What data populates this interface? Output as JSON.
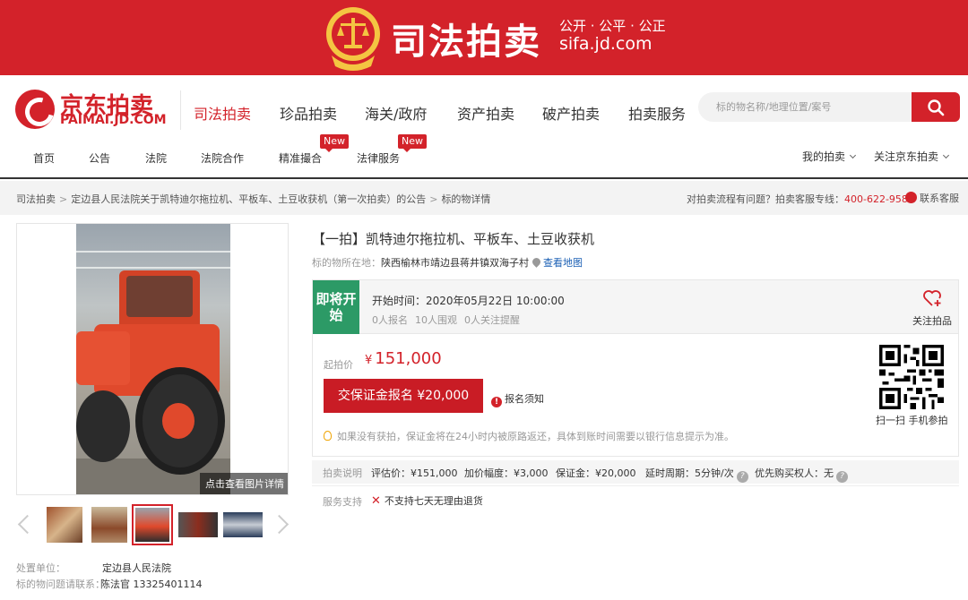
{
  "banner": {
    "title": "司法拍卖",
    "slogan": "公开 · 公平 · 公正",
    "site": "sifa.jd.com"
  },
  "logo": {
    "cn": "京东拍卖",
    "en": "PAIMAI.JD.COM"
  },
  "main_nav": [
    "司法拍卖",
    "珍品拍卖",
    "海关/政府",
    "资产拍卖",
    "破产拍卖",
    "拍卖服务"
  ],
  "search": {
    "placeholder": "标的物名称/地理位置/案号"
  },
  "sub_nav": {
    "items": [
      "首页",
      "公告",
      "法院",
      "法院合作",
      "精准撮合",
      "法律服务"
    ],
    "badge": "New",
    "my_auction": "我的拍卖",
    "follow_jd": "关注京东拍卖"
  },
  "breadcrumb": {
    "items": [
      "司法拍卖",
      "定边县人民法院关于凯特迪尔拖拉机、平板车、土豆收获机（第一次拍卖）的公告",
      "标的物详情"
    ],
    "sep": ">"
  },
  "hotline": {
    "text": "对拍卖流程有问题？拍卖客服专线：",
    "number": "400-622-9586",
    "kefu": "联系客服"
  },
  "gallery": {
    "caption": "点击查看图片详情",
    "thumb_count": 5,
    "selected_thumb": 3
  },
  "owner": {
    "label": "处置单位：",
    "value": "定边县人民法院",
    "contact_label": "标的物问题请联系：",
    "contact_value": "陈法官 13325401114"
  },
  "item": {
    "title": "【一拍】凯特迪尔拖拉机、平板车、土豆收获机",
    "location_label": "标的物所在地：",
    "location": "陕西榆林市靖边县蒋井镇双海子村",
    "map_link": "查看地图"
  },
  "auction": {
    "status": "即将开始",
    "start_time": "开始时间：2020年05月22日 10:00:00",
    "signups": "0人报名",
    "watchers": "10人围观",
    "reminders": "0人关注提醒",
    "follow": "关注拍品",
    "start_price_label": "起拍价",
    "currency": "¥",
    "start_price": "151,000",
    "deposit_button": "交保证金报名 ¥20,000",
    "notice": "报名须知",
    "tip": "如果没有获拍，保证金将在24小时内被原路返还，具体到账时间需要以银行信息提示为准。",
    "qr_label": "扫一扫 手机参拍"
  },
  "info_row": {
    "label": "拍卖说明",
    "appraisal": "评估价：¥151,000",
    "increment": "加价幅度：¥3,000",
    "deposit": "保证金：¥20,000",
    "delay": "延时周期：5分钟/次",
    "priority": "优先购买权人：无"
  },
  "service": {
    "label": "服务支持",
    "value": "不支持七天无理由退货"
  },
  "colors": {
    "brand_red": "#d3222a",
    "status_green": "#2c9a66",
    "link_blue": "#1a5fb4"
  }
}
